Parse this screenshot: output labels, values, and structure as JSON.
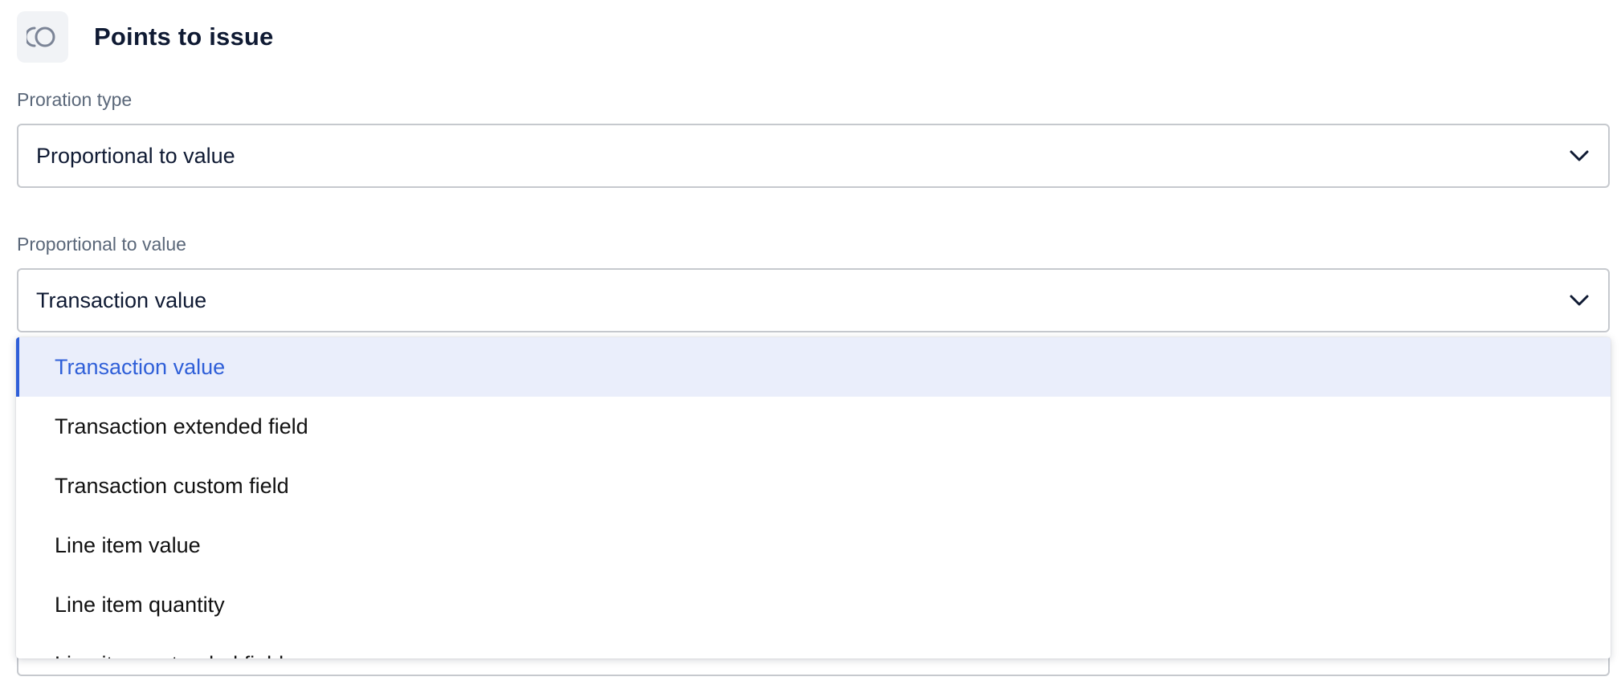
{
  "header": {
    "icon": "toggle-circle-icon",
    "title": "Points to issue"
  },
  "proration_type": {
    "label": "Proration type",
    "value": "Proportional to value"
  },
  "proportional_to": {
    "label": "Proportional to value",
    "value": "Transaction value",
    "expanded": true
  },
  "dropdown": {
    "options": [
      {
        "label": "Transaction value",
        "selected": true
      },
      {
        "label": "Transaction extended field",
        "selected": false
      },
      {
        "label": "Transaction custom field",
        "selected": false
      },
      {
        "label": "Line item value",
        "selected": false
      },
      {
        "label": "Line item quantity",
        "selected": false
      },
      {
        "label": "Line item extended field",
        "selected": false
      }
    ]
  },
  "colors": {
    "accent": "#2f5fd8",
    "selected_bg": "#eaeefb",
    "label": "#5a6779",
    "border": "#c6c9ce"
  }
}
